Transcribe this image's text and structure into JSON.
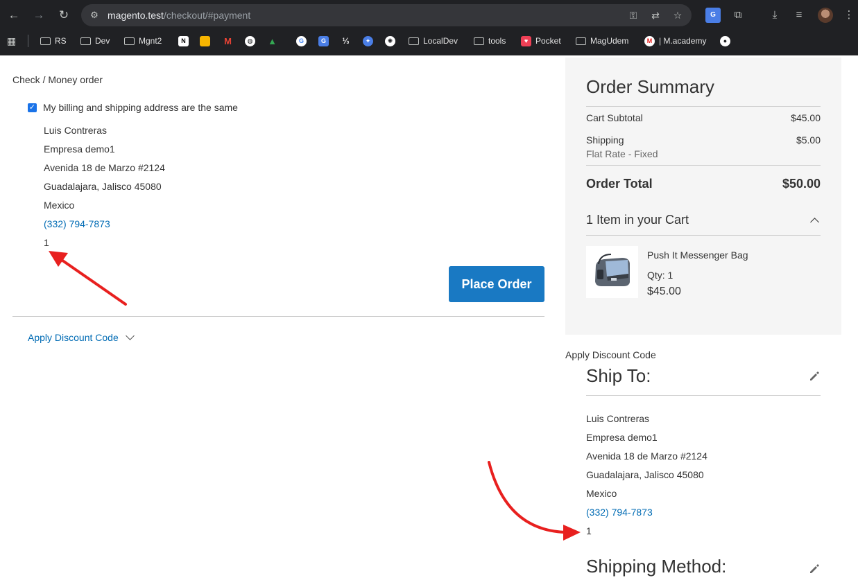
{
  "browser": {
    "url_host": "magento.test",
    "url_path": "/checkout/#payment",
    "bookmarks": [
      "RS",
      "Dev",
      "Mgnt2",
      "LocalDev",
      "tools",
      "Pocket",
      "MagUdem",
      "| M.academy"
    ]
  },
  "payment": {
    "method_title": "Check / Money order",
    "same_address_label": "My billing and shipping address are the same",
    "same_address_checked": true,
    "address": {
      "name": "Luis Contreras",
      "company": "Empresa demo1",
      "street": "Avenida 18 de Marzo #2124",
      "city_line": "Guadalajara, Jalisco 45080",
      "country": "Mexico",
      "phone": "(332) 794-7873",
      "extra": "1"
    },
    "place_order_label": "Place Order",
    "discount_toggle_label": "Apply Discount Code"
  },
  "summary": {
    "title": "Order Summary",
    "subtotal_label": "Cart Subtotal",
    "subtotal_value": "$45.00",
    "shipping_label": "Shipping",
    "shipping_value": "$5.00",
    "shipping_method": "Flat Rate - Fixed",
    "total_label": "Order Total",
    "total_value": "$50.00",
    "cart_count_label": "1 Item in your Cart",
    "item": {
      "name": "Push It Messenger Bag",
      "qty": "Qty: 1",
      "price": "$45.00"
    }
  },
  "sidebar": {
    "apply_discount_label": "Apply Discount Code",
    "ship_to_title": "Ship To:",
    "ship_address": {
      "name": "Luis Contreras",
      "company": "Empresa demo1",
      "street": "Avenida 18 de Marzo #2124",
      "city_line": "Guadalajara, Jalisco 45080",
      "country": "Mexico",
      "phone": "(332) 794-7873",
      "extra": "1"
    },
    "shipping_method_title": "Shipping Method:"
  },
  "colors": {
    "link": "#006bb4",
    "primary_button": "#1979c3",
    "annotation_arrow": "#e8201f"
  }
}
